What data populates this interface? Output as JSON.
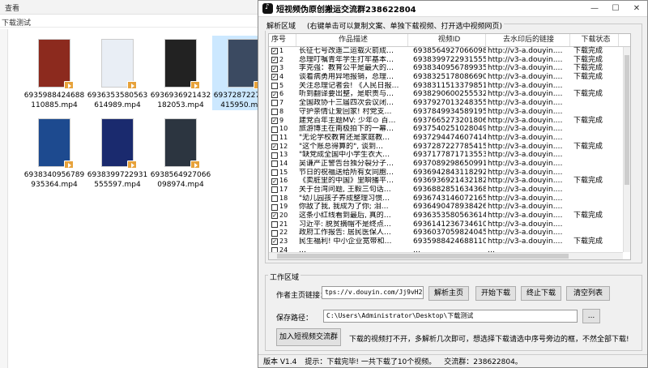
{
  "explorer": {
    "menu": "查看",
    "path": "下载测试",
    "files": [
      {
        "name": "6935988424688110885.mp4",
        "color": "#8c2a1e"
      },
      {
        "name": "6936353580563614989.mp4",
        "color": "#e9eef5"
      },
      {
        "name": "6936936921432182053.mp4",
        "color": "#222222"
      },
      {
        "name": "6937287227785415950.mp4",
        "color": "#3b4a61"
      },
      {
        "name": "6938340956789935364.mp4",
        "color": "#1d4a8f"
      },
      {
        "name": "6938399722931555597.mp4",
        "color": "#1a2a6e"
      },
      {
        "name": "6938564927066098974.mp4",
        "color": "#2c3540"
      }
    ]
  },
  "app": {
    "title": "短视频伪原创搬运交流群238622804",
    "minimize": "—",
    "maximize": "☐",
    "close": "✕",
    "parse_section": "解析区域",
    "parse_hint": "(右键单击可以复制文案、单独下载视频、打开选中视频网页)",
    "columns": [
      "序号",
      "作品描述",
      "视频ID",
      "去水印后的链接",
      "下载状态"
    ],
    "rows": [
      {
        "checked": true,
        "no": "1",
        "desc": "长征七号改遥二运载火箭成…",
        "id": "6938564927066098974",
        "link": "http://v3-a.douyin.…",
        "status": "下载完成"
      },
      {
        "checked": true,
        "no": "2",
        "desc": "总理叮嘱青年学生打牢基本…",
        "id": "6938399722931555597",
        "link": "http://v3-a.douyin.…",
        "status": "下载完成"
      },
      {
        "checked": true,
        "no": "3",
        "desc": "李克强：教育公平是最大的…",
        "id": "6938340956789935364",
        "link": "http://v3-a.douyin.…",
        "status": "下载完成"
      },
      {
        "checked": true,
        "no": "4",
        "desc": "谈着病勇用异地报销，总理…",
        "id": "6938325178086690056",
        "link": "http://v3-a.douyin.…",
        "status": "下载完成"
      },
      {
        "checked": false,
        "no": "5",
        "desc": "关注总理记者会! 《人民日报…",
        "id": "6938311513379851553",
        "link": "http://v3-a.douyin.…",
        "status": ""
      },
      {
        "checked": true,
        "no": "6",
        "desc": "听到翻译要出整，是职责与…",
        "id": "6938290600255532424",
        "link": "http://v3-a.douyin.…",
        "status": "下载完成"
      },
      {
        "checked": false,
        "no": "7",
        "desc": "全国政协十三届四次会议闭…",
        "id": "6937927013248355621",
        "link": "http://v3-a.douyin.…",
        "status": ""
      },
      {
        "checked": false,
        "no": "8",
        "desc": "守护亲情让爱回家! 村党支…",
        "id": "6937849934589195940",
        "link": "http://v3-a.douyin.…",
        "status": ""
      },
      {
        "checked": true,
        "no": "9",
        "desc": "建党百年主题MV: 少年⊙ 百…",
        "id": "6937665273201806606",
        "link": "http://v3-a.douyin.…",
        "status": "下载完成"
      },
      {
        "checked": false,
        "no": "10",
        "desc": "旅游博主在南极拍下的一幕…",
        "id": "6937540251028049163",
        "link": "http://v3-a.douyin.…",
        "status": ""
      },
      {
        "checked": false,
        "no": "11",
        "desc": "\"无论学校教育还是家庭教…",
        "id": "6937294474607414535",
        "link": "http://v3-a.douyin.…",
        "status": ""
      },
      {
        "checked": true,
        "no": "12",
        "desc": "\"这个账总得算的\", 谈到…",
        "id": "6937287227785415950",
        "link": "http://v3-a.douyin.…",
        "status": "下载完成"
      },
      {
        "checked": false,
        "no": "13",
        "desc": "\"缺党成全国中小学生衣大…",
        "id": "6937177871713553441",
        "link": "http://v3-a.douyin.…",
        "status": ""
      },
      {
        "checked": false,
        "no": "14",
        "desc": "吴谦严正警告台独分裂分子…",
        "id": "6937089298650991885",
        "link": "http://v3-a.douyin.…",
        "status": ""
      },
      {
        "checked": false,
        "no": "15",
        "desc": "节日的祝福送给所有女同胞…",
        "id": "6936942843118292254",
        "link": "http://v3-a.douyin.…",
        "status": ""
      },
      {
        "checked": true,
        "no": "16",
        "desc": "《卖脏里的中国》里瞬播平…",
        "id": "6936936921432182053",
        "link": "http://v3-a.douyin.…",
        "status": "下载完成"
      },
      {
        "checked": false,
        "no": "17",
        "desc": "关于台湾问题, 王毅三句话…",
        "id": "6936882851634368414",
        "link": "http://v3-a.douyin.…",
        "status": ""
      },
      {
        "checked": false,
        "no": "18",
        "desc": "\"幼儿园孩子养成整理习惯…",
        "id": "6936743146072165646",
        "link": "http://v3-a.douyin.…",
        "status": ""
      },
      {
        "checked": false,
        "no": "19",
        "desc": "你敌了我, 我成为了你; 泪…",
        "id": "6936490478938426631",
        "link": "http://v3-a.douyin.…",
        "status": ""
      },
      {
        "checked": true,
        "no": "20",
        "desc": "这条小红线看到最后, 真的…",
        "id": "6936353580563614989",
        "link": "http://v3-a.douyin.…",
        "status": "下载完成"
      },
      {
        "checked": false,
        "no": "21",
        "desc": "习近平: 脱贫摘帽不是终点…",
        "id": "6936141236734610718",
        "link": "http://v3-a.douyin.…",
        "status": ""
      },
      {
        "checked": false,
        "no": "22",
        "desc": "政府工作报告: 居民医保人…",
        "id": "6936037059824045326",
        "link": "http://v3-a.douyin.…",
        "status": ""
      },
      {
        "checked": true,
        "no": "23",
        "desc": "民生福利! 中小企业宽带和…",
        "id": "6935988424688110885",
        "link": "http://v3-a.douyin.…",
        "status": "下载完成"
      },
      {
        "checked": false,
        "no": "24",
        "desc": "…",
        "id": "…",
        "link": "…",
        "status": ""
      }
    ],
    "work_section": "工作区域",
    "author_label": "作者主页链接：",
    "author_value": "tps://v.douyin.com/Jj9vH2s/",
    "parse_btn": "解析主页",
    "start_btn": "开始下载",
    "stop_btn": "终止下载",
    "clear_btn": "清空列表",
    "save_label": "保存路径：",
    "save_value": "C:\\Users\\Administrator\\Desktop\\下载测试",
    "browse_btn": "...",
    "join_btn": "加入短视频交流群",
    "notice": "下载的视频打不开，多解析几次即可，想选择下载请选中序号旁边的框，不然全部下载!",
    "version": "版本 V1.4",
    "tip": "提示：下载完毕! 一共下载了10个视频。",
    "group": "交流群：238622804。"
  }
}
